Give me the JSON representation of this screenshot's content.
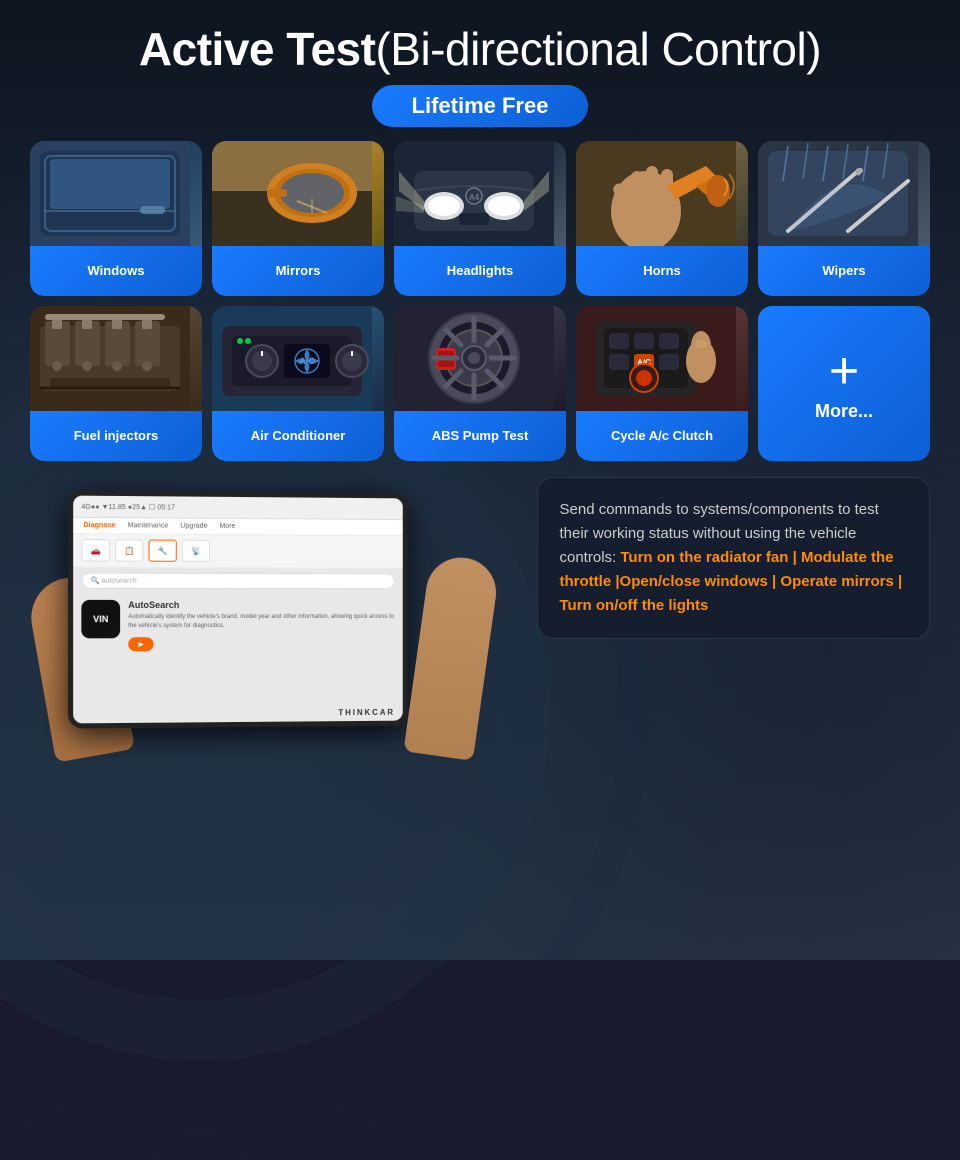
{
  "header": {
    "title_bold": "Active Test",
    "title_normal": "(Bi-directional Control)",
    "badge": "Lifetime Free"
  },
  "row1": [
    {
      "id": "windows",
      "label": "Windows",
      "emoji": "🪟",
      "bg_class": "img-windows"
    },
    {
      "id": "mirrors",
      "label": "Mirrors",
      "emoji": "🪞",
      "bg_class": "img-mirrors"
    },
    {
      "id": "headlights",
      "label": "Headlights",
      "emoji": "💡",
      "bg_class": "img-headlights"
    },
    {
      "id": "horns",
      "label": "Horns",
      "emoji": "📯",
      "bg_class": "img-horns"
    },
    {
      "id": "wipers",
      "label": "Wipers",
      "emoji": "🌧️",
      "bg_class": "img-wipers"
    }
  ],
  "row2": [
    {
      "id": "fuel-injectors",
      "label": "Fuel injectors",
      "emoji": "⚙️",
      "bg_class": "img-fuel"
    },
    {
      "id": "air-conditioner",
      "label": "Air Conditioner",
      "emoji": "❄️",
      "bg_class": "img-ac"
    },
    {
      "id": "abs-pump",
      "label": "ABS Pump Test",
      "emoji": "🔧",
      "bg_class": "img-abs"
    },
    {
      "id": "cycle-ac",
      "label": "Cycle A/c Clutch",
      "emoji": "🔄",
      "bg_class": "img-cycle"
    }
  ],
  "more": {
    "plus": "+",
    "label": "More..."
  },
  "tablet": {
    "brand": "THINKCAR",
    "nav_items": [
      "Diagnose",
      "Maintenance",
      "Upgrade",
      "More"
    ],
    "search_placeholder": "autosearch",
    "feature_title": "AutoSearch",
    "feature_desc": "Automatically identify the vehicle's brand, model year and other information, allowing quick access to the vehicle's system for diagnostics.",
    "button_label": "▶"
  },
  "info": {
    "text_normal": "Send commands to systems/components to test their working status without using the vehicle controls:",
    "text_highlight": "Turn on the radiator fan | Modulate the throttle |Open/close windows | Operate mirrors | Turn on/off the lights"
  }
}
